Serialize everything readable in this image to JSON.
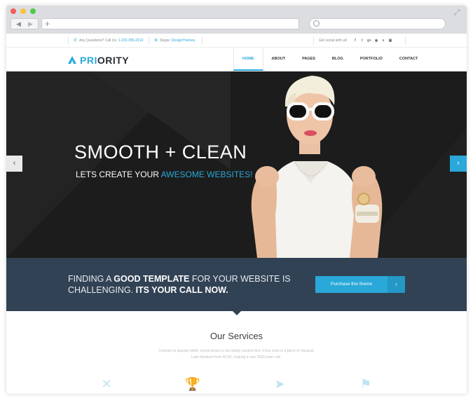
{
  "browser": {
    "back_glyph": "◀",
    "forward_glyph": "▶",
    "new_tab_glyph": "+",
    "expand_glyph": "⤢"
  },
  "topbar": {
    "phone_label": "Any Questions? Call Us:",
    "phone_number": "1-223-355-2214",
    "skype_label": "Skype:",
    "skype_name": "DesignThemes",
    "social_label": "Get social with us!",
    "social_icons": [
      "f",
      "t",
      "g+",
      "◉",
      "s",
      "▣"
    ]
  },
  "header": {
    "logo_accent": "PRI",
    "logo_rest": "ORITY",
    "menu": [
      "HOME",
      "ABOUT",
      "PAGES",
      "BLOG",
      "PORTFOLIO",
      "CONTACT"
    ]
  },
  "hero": {
    "title": "SMOOTH + CLEAN",
    "subtitle_prefix": "LETS CREATE YOUR ",
    "subtitle_accent": "AWESOME WEBSITES!",
    "prev_glyph": "‹",
    "next_glyph": "›"
  },
  "cta": {
    "line1_a": "FINDING A ",
    "line1_b": "GOOD TEMPLATE",
    "line1_c": " FOR YOUR WEBSITE IS",
    "line2_a": "CHALLENGING. ",
    "line2_b": "ITS YOUR CALL NOW.",
    "button_label": "Purchase this theme",
    "button_chevron": "›"
  },
  "services": {
    "title": "Our Services",
    "description_line1": "Contrary to popular belief, Lorem Ipsum is not simply random text. It has roots in a piece of classical",
    "description_line2": "Latin literature from 45 BC, making it over 2000 years old.",
    "icons": [
      "✕",
      "🏆",
      "➤",
      "⚑"
    ]
  },
  "colors": {
    "accent": "#29a8d9",
    "cta_background": "#324255",
    "hero_background": "#1c1c1c"
  }
}
